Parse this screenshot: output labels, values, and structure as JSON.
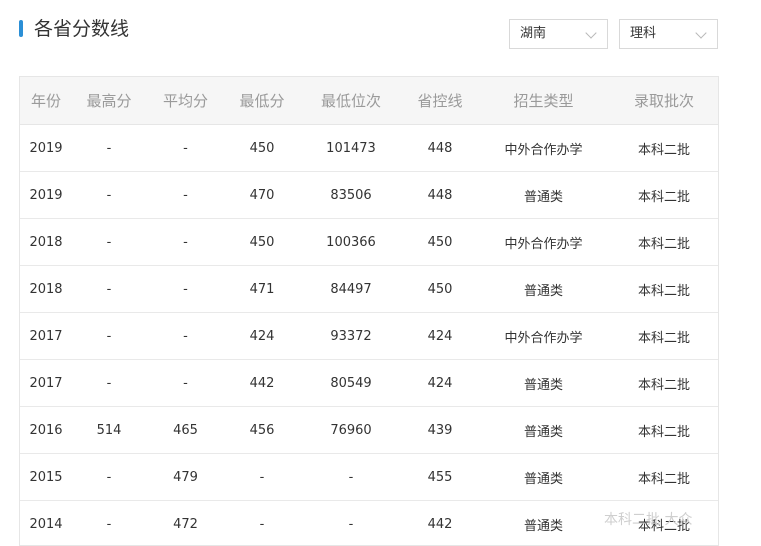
{
  "section": {
    "title": "各省分数线",
    "accent_color": "#2b8fd6"
  },
  "filters": {
    "province": "湖南",
    "subject": "理科"
  },
  "table": {
    "headers": [
      "年份",
      "最高分",
      "平均分",
      "最低分",
      "最低位次",
      "省控线",
      "招生类型",
      "录取批次"
    ],
    "rows": [
      [
        "2019",
        "-",
        "-",
        "450",
        "101473",
        "448",
        "中外合作办学",
        "本科二批"
      ],
      [
        "2019",
        "-",
        "-",
        "470",
        "83506",
        "448",
        "普通类",
        "本科二批"
      ],
      [
        "2018",
        "-",
        "-",
        "450",
        "100366",
        "450",
        "中外合作办学",
        "本科二批"
      ],
      [
        "2018",
        "-",
        "-",
        "471",
        "84497",
        "450",
        "普通类",
        "本科二批"
      ],
      [
        "2017",
        "-",
        "-",
        "424",
        "93372",
        "424",
        "中外合作办学",
        "本科二批"
      ],
      [
        "2017",
        "-",
        "-",
        "442",
        "80549",
        "424",
        "普通类",
        "本科二批"
      ],
      [
        "2016",
        "514",
        "465",
        "456",
        "76960",
        "439",
        "普通类",
        "本科二批"
      ],
      [
        "2015",
        "-",
        "479",
        "-",
        "-",
        "455",
        "普通类",
        "本科二批"
      ],
      [
        "2014",
        "-",
        "472",
        "-",
        "-",
        "442",
        "普通类",
        "本科二批"
      ]
    ]
  },
  "watermark": "本科二批 大众"
}
